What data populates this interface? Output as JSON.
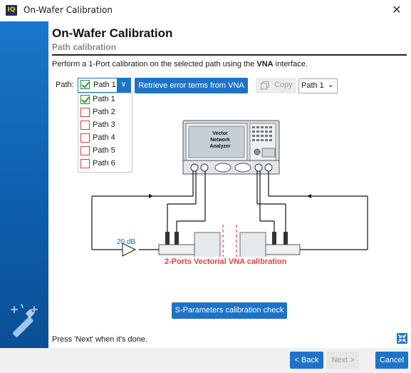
{
  "window": {
    "title": "On-Wafer Calibration",
    "logo_text": "IQ",
    "close_glyph": "✕"
  },
  "header": {
    "title": "On-Wafer Calibration",
    "subtitle": "Path calibration"
  },
  "instruction": {
    "before": "Perform a 1-Port calibration on the selected path using the ",
    "bold": "VNA",
    "after": " interface."
  },
  "path": {
    "label": "Path:",
    "selected": "Path 1",
    "options": [
      {
        "label": "Path 1",
        "checked": true
      },
      {
        "label": "Path 2",
        "checked": false
      },
      {
        "label": "Path 3",
        "checked": false
      },
      {
        "label": "Path 4",
        "checked": false
      },
      {
        "label": "Path 5",
        "checked": false
      },
      {
        "label": "Path 6",
        "checked": false
      }
    ]
  },
  "toolbar": {
    "retrieve_label": "Retrieve error terms from VNA",
    "copy_label": "Copy",
    "copy_target": "Path 1"
  },
  "diagram": {
    "vna_line1": "Vector",
    "vna_line2": "Network",
    "vna_line3": "Analyzer",
    "amplifier_label": "20 dB",
    "calibration_label": "2-Ports Vectorial VNA calibration"
  },
  "actions": {
    "sparam_label": "S-Parameters calibration check"
  },
  "status": {
    "press_next": "Press 'Next' when it's done."
  },
  "footer": {
    "back_label": "< Back",
    "next_label": "Next >",
    "cancel_label": "Cancel"
  },
  "colors": {
    "accent": "#1e73c8",
    "calibration_text": "#e84040",
    "sidebar": "#1a77c9"
  }
}
